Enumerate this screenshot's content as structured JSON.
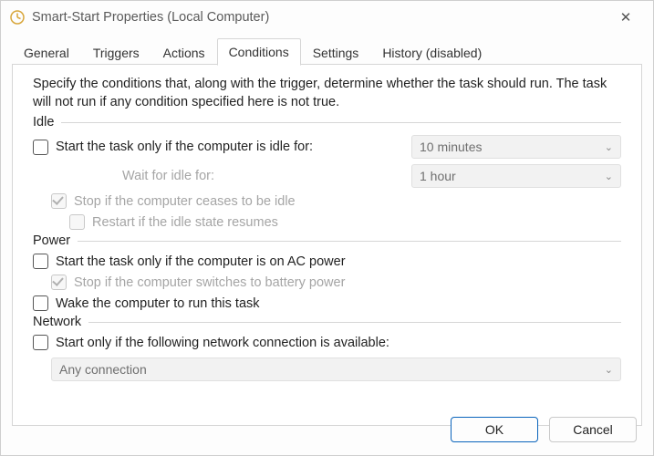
{
  "window": {
    "title": "Smart-Start Properties (Local Computer)"
  },
  "tabs": {
    "general": "General",
    "triggers": "Triggers",
    "actions": "Actions",
    "conditions": "Conditions",
    "settings": "Settings",
    "history": "History (disabled)"
  },
  "description": "Specify the conditions that, along with the trigger, determine whether the task should run.  The task will not run  if any condition specified here is not true.",
  "sections": {
    "idle": {
      "legend": "Idle",
      "start_only_idle": "Start the task only if the computer is idle for:",
      "idle_duration": "10 minutes",
      "wait_label": "Wait for idle for:",
      "wait_duration": "1 hour",
      "stop_if_not_idle": "Stop if the computer ceases to be idle",
      "restart_if_resumes": "Restart if the idle state resumes"
    },
    "power": {
      "legend": "Power",
      "start_on_ac": "Start the task only if the computer is on AC power",
      "stop_on_battery": "Stop if the computer switches to battery power",
      "wake_to_run": "Wake the computer to run this task"
    },
    "network": {
      "legend": "Network",
      "start_if_network": "Start only if the following network connection is available:",
      "connection": "Any connection"
    }
  },
  "buttons": {
    "ok": "OK",
    "cancel": "Cancel"
  }
}
